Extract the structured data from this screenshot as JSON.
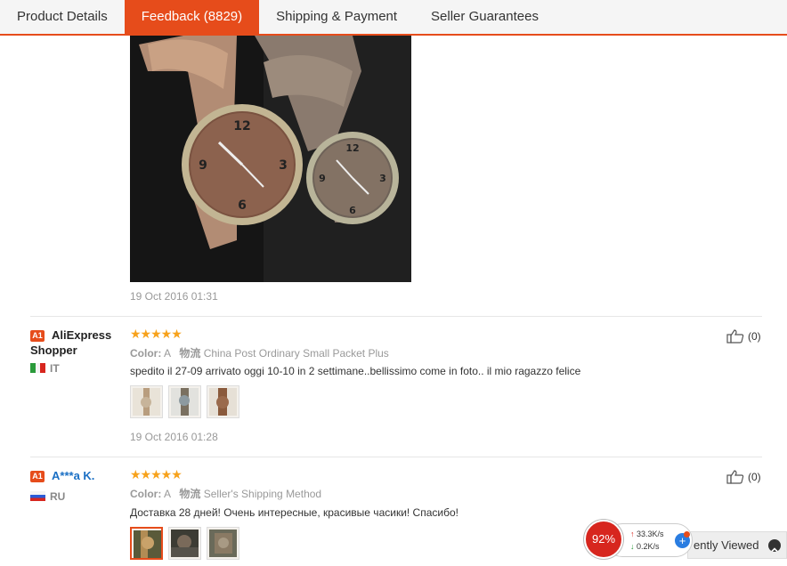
{
  "tabs": [
    {
      "label": "Product Details"
    },
    {
      "label": "Feedback (8829)",
      "active": true
    },
    {
      "label": "Shipping & Payment"
    },
    {
      "label": "Seller Guarantees"
    }
  ],
  "first_photo_date": "19 Oct 2016 01:31",
  "reviews": [
    {
      "badge": "A1",
      "name": "AliExpress Shopper",
      "country": "IT",
      "stars": "★★★★★",
      "color_label": "Color:",
      "color_value": "A",
      "shipping_label": "物流",
      "shipping_value": "China Post Ordinary Small Packet Plus",
      "text": "spedito il 27-09 arrivato oggi 10-10 in 2 settimane..bellissimo come in foto.. il mio ragazzo felice",
      "helpful": "(0)",
      "date": "19 Oct 2016 01:28"
    },
    {
      "badge": "A1",
      "name": "A***a K.",
      "country": "RU",
      "stars": "★★★★★",
      "color_label": "Color:",
      "color_value": "A",
      "shipping_label": "物流",
      "shipping_value": "Seller's Shipping Method",
      "text": "Доставка 28 дней! Очень интересные, красивые часики! Спасибо!",
      "helpful": "(0)"
    }
  ],
  "speed_widget": {
    "percent": "92%",
    "upload": "33.3K/s",
    "download": "0.2K/s"
  },
  "recently_viewed": "ently Viewed",
  "colors": {
    "accent": "#e64c1b",
    "star": "#f7a21b",
    "link": "#1a6fc4"
  }
}
